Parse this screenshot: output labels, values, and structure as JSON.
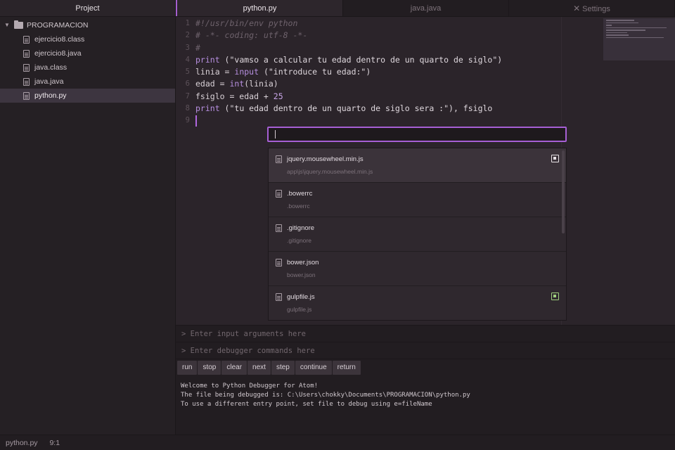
{
  "sidebar": {
    "title": "Project",
    "root": "PROGRAMACION",
    "files": [
      "ejercicio8.class",
      "ejercicio8.java",
      "java.class",
      "java.java",
      "python.py"
    ]
  },
  "tabs": [
    {
      "label": "python.py",
      "active": true
    },
    {
      "label": "java.java",
      "active": false
    },
    {
      "label": "Settings",
      "active": false,
      "icon": "wrench-icon"
    }
  ],
  "editor": {
    "lines": [
      [
        {
          "t": "#!/usr/bin/env python",
          "c": "cm"
        }
      ],
      [
        {
          "t": "# -*- coding: utf-8 -*-",
          "c": "cm"
        }
      ],
      [
        {
          "t": "#",
          "c": "cm"
        }
      ],
      [
        {
          "t": "print",
          "c": "kw"
        },
        {
          "t": " (\"vamso a calcular tu edad dentro de un quarto de siglo\")",
          "c": "str"
        }
      ],
      [
        {
          "t": "linia = ",
          "c": "op"
        },
        {
          "t": "input",
          "c": "kw"
        },
        {
          "t": " (\"introduce tu edad:\")",
          "c": "str"
        }
      ],
      [
        {
          "t": "edad = ",
          "c": "op"
        },
        {
          "t": "int",
          "c": "kw"
        },
        {
          "t": "(linia)",
          "c": "op"
        }
      ],
      [
        {
          "t": "fsiglo = edad + ",
          "c": "op"
        },
        {
          "t": "25",
          "c": "num"
        }
      ],
      [
        {
          "t": "print",
          "c": "kw"
        },
        {
          "t": " (\"tu edad dentro de un quarto de siglo sera :\"), fsiglo",
          "c": "str"
        }
      ],
      []
    ]
  },
  "finder": {
    "query": "",
    "items": [
      {
        "name": "jquery.mousewheel.min.js",
        "path": "app\\js\\jquery.mousewheel.min.js",
        "status": "modified-icon"
      },
      {
        "name": ".bowerrc",
        "path": ".bowerrc",
        "status": ""
      },
      {
        "name": ".gitignore",
        "path": ".gitignore",
        "status": ""
      },
      {
        "name": "bower.json",
        "path": "bower.json",
        "status": ""
      },
      {
        "name": "gulpfile.js",
        "path": "gulpfile.js",
        "status": "added-icon"
      }
    ]
  },
  "debugger": {
    "args_placeholder": "> Enter input arguments here",
    "cmd_placeholder": "> Enter debugger commands here",
    "buttons": [
      "run",
      "stop",
      "clear",
      "next",
      "step",
      "continue",
      "return"
    ],
    "output": [
      "Welcome to Python Debugger for Atom!",
      "The file being debugged is: C:\\Users\\chokky\\Documents\\PROGRAMACION\\python.py",
      "To use a different entry point, set file to debug using e=fileName"
    ]
  },
  "statusbar": {
    "file": "python.py",
    "position": "9:1"
  },
  "colors": {
    "accent": "#a65fd4",
    "added": "#9fcf7e"
  }
}
